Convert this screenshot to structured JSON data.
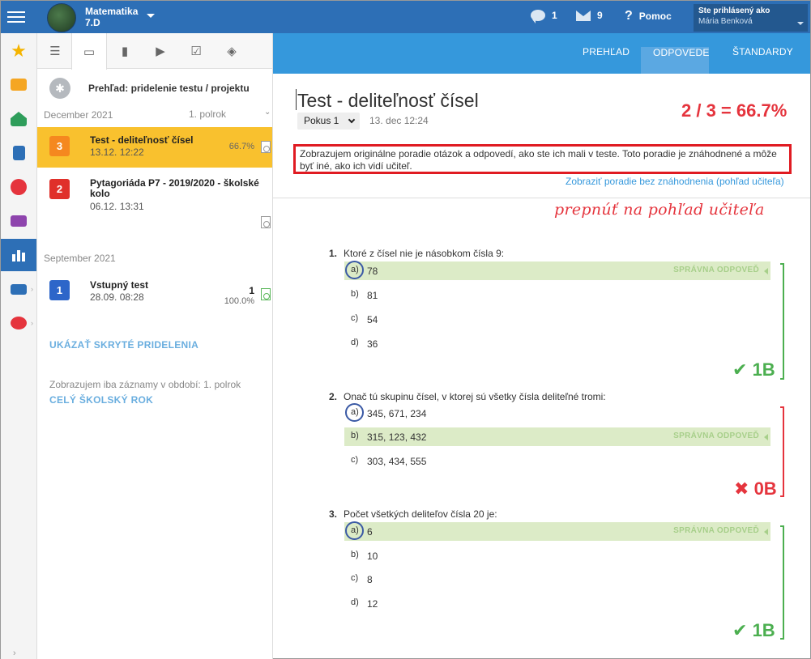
{
  "topbar": {
    "class_line1": "Matematika",
    "class_line2": "7.D",
    "messages_count": "1",
    "mail_count": "9",
    "help_label": "Pomoc",
    "user_label": "Ste prihlásený ako",
    "user_name": "Mária Benková",
    "help_icon": "question-icon"
  },
  "rail": {
    "icons": [
      "star-icon",
      "mail-icon",
      "home-icon",
      "book-icon",
      "grade-icon",
      "schedule-icon",
      "chart-icon",
      "open-book-icon",
      "chat-icon"
    ],
    "colors": [
      "#f5b400",
      "#f5a623",
      "#2e9d5a",
      "#2d6fb6",
      "#e5343d",
      "#8e44ad",
      "#ffffff",
      "#2d6fb6",
      "#e5343d"
    ]
  },
  "left": {
    "tabs": [
      "menu-icon",
      "test-icon",
      "backpack-icon",
      "video-icon",
      "checklist-icon",
      "package-icon"
    ],
    "overview": "Prehľad: pridelenie testu / projektu",
    "section1": "December 2021",
    "period": "1. polrok",
    "items": [
      {
        "num": "3",
        "title": "Test - deliteľnosť čísel",
        "date": "13.12. 12:22",
        "pct": "66.7%",
        "color": "#f5881f"
      },
      {
        "num": "2",
        "title": "Pytagoriáda P7 - 2019/2020 - školské kolo",
        "date": "06.12. 13:31",
        "pct": "",
        "color": "#e0302a"
      },
      {
        "num": "1",
        "title": "Vstupný test",
        "date": "28.09. 08:28",
        "pct": "100.0%",
        "score": "1",
        "color": "#2d66c9"
      }
    ],
    "section2": "September 2021",
    "show_hidden": "UKÁZAŤ SKRYTÉ PRIDELENIA",
    "note": "Zobrazujem iba záznamy v období: 1. polrok",
    "full_year": "CELÝ ŠKOLSKÝ ROK"
  },
  "right": {
    "tabs": [
      "PREHĽAD",
      "ODPOVEDE",
      "ŠTANDARDY"
    ],
    "title": "Test - deliteľnosť čísel",
    "attempt": "Pokus 1",
    "date": "13. dec 12:24",
    "score": "2 / 3 = 66.7%",
    "info": "Zobrazujem originálne poradie otázok a odpovedí, ako ste ich mali v teste. Toto poradie je znáhodnené a môže byť iné, ako ich vidí učiteľ.",
    "teacher_link": "Zobraziť poradie bez znáhodnenia (pohľad učiteľa)",
    "handwritten": "prepnúť na pohľad učiteľa",
    "correct_label": "SPRÁVNA ODPOVEĎ"
  },
  "questions": [
    {
      "num": "1.",
      "text": "Ktoré z čísel nie je násobkom čísla 9:",
      "options": [
        {
          "l": "a)",
          "t": "78"
        },
        {
          "l": "b)",
          "t": "81"
        },
        {
          "l": "c)",
          "t": "54"
        },
        {
          "l": "d)",
          "t": "36"
        }
      ],
      "points": "1B",
      "result": "good"
    },
    {
      "num": "2.",
      "text": "Onač tú skupinu čísel, v ktorej sú všetky čísla deliteľné tromi:",
      "options": [
        {
          "l": "a)",
          "t": "345, 671, 234"
        },
        {
          "l": "b)",
          "t": "315, 123, 432"
        },
        {
          "l": "c)",
          "t": "303, 434, 555"
        }
      ],
      "points": "0B",
      "result": "bad"
    },
    {
      "num": "3.",
      "text": "Počet všetkých deliteľov čísla 20 je:",
      "options": [
        {
          "l": "a)",
          "t": "6"
        },
        {
          "l": "b)",
          "t": "10"
        },
        {
          "l": "c)",
          "t": "8"
        },
        {
          "l": "d)",
          "t": "12"
        }
      ],
      "points": "1B",
      "result": "good"
    }
  ]
}
